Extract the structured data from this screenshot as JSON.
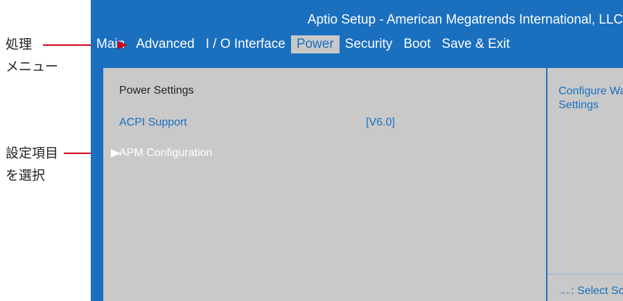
{
  "annotations": {
    "menu_label_line1": "処理",
    "menu_label_line2": "メニュー",
    "item_label_line1": "設定項目",
    "item_label_line2": "を選択"
  },
  "window": {
    "title": "Aptio Setup - American Megatrends International, LLC"
  },
  "tabs": [
    {
      "label": "Main",
      "active": false
    },
    {
      "label": "Advanced",
      "active": false
    },
    {
      "label": "I / O Interface",
      "active": false
    },
    {
      "label": "Power",
      "active": true
    },
    {
      "label": "Security",
      "active": false
    },
    {
      "label": "Boot",
      "active": false
    },
    {
      "label": "Save & Exit",
      "active": false
    }
  ],
  "main": {
    "heading": "Power Settings",
    "acpi_label": "ACPI Support",
    "acpi_value": "[V6.0]",
    "apm_label": "APM Configuration"
  },
  "help": {
    "text": "Configure Wake Settings",
    "legend_icon": "left-right-arrows-icon",
    "legend_glyph": "→←",
    "legend_text": ": Select Screen"
  },
  "colors": {
    "bios_blue": "#1a6fbf",
    "panel_gray": "#c9c9c9",
    "annotation_red": "#d0021b"
  }
}
